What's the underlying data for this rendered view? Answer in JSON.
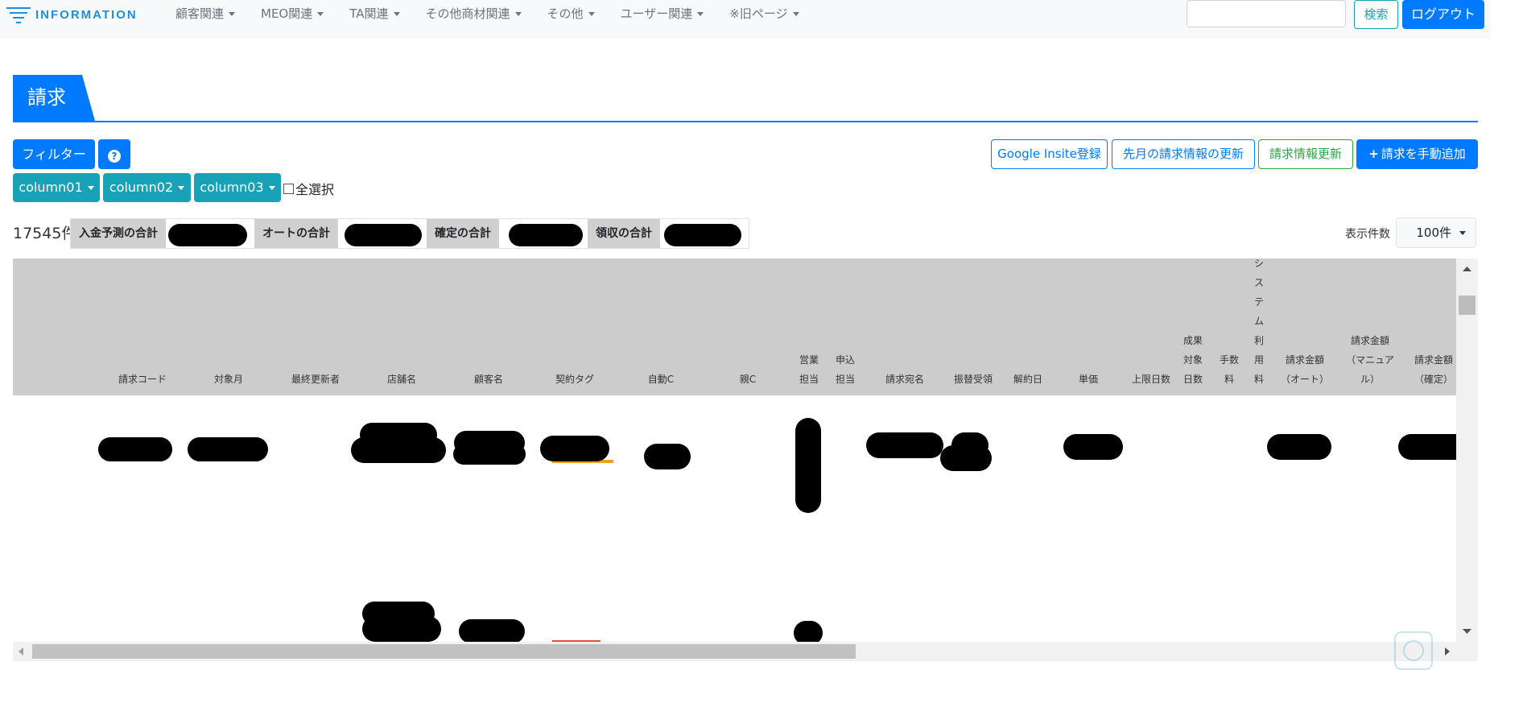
{
  "brand": {
    "logo_text": "INFORMATION"
  },
  "nav": {
    "items": [
      {
        "label": "顧客関連"
      },
      {
        "label": "MEO関連"
      },
      {
        "label": "TA関連"
      },
      {
        "label": "その他商材関連"
      },
      {
        "label": "その他"
      },
      {
        "label": "ユーザー関連"
      },
      {
        "label": "※旧ページ"
      }
    ],
    "search_placeholder": "",
    "search_button": "検索",
    "logout_button": "ログアウト"
  },
  "page": {
    "title": "請求"
  },
  "toolbar": {
    "filter_button": "フィルター",
    "help_icon": "?",
    "column_buttons": [
      "column01",
      "column02",
      "column03"
    ],
    "select_all_label": "全選択",
    "google_insite_button": "Google Insite登録",
    "update_last_month_button": "先月の請求情報の更新",
    "update_billing_button": "請求情報更新",
    "add_manual_button": "請求を手動追加",
    "plus_icon": "+"
  },
  "summary": {
    "count": "17545件",
    "totals": [
      {
        "label": "入金予測の合計"
      },
      {
        "label": "オートの合計"
      },
      {
        "label": "確定の合計"
      },
      {
        "label": "領収の合計"
      }
    ],
    "per_page_label": "表示件数",
    "per_page_value": "100件"
  },
  "table": {
    "headers": [
      "請求コード",
      "対象月",
      "最終更新者",
      "店舗名",
      "顧客名",
      "契約タグ",
      "自動C",
      "親C",
      "営業\n担当",
      "申込\n担当",
      "請求宛名",
      "振替受領",
      "解約日",
      "単価",
      "上限日数",
      "成果\n対象\n日数",
      "手数\n料",
      "シ\nス\nテ\nム\n利\n用\n料",
      "請求金額\n（オート）",
      "請求金額\n（マニュア\nル）",
      "請求金額\n（確定）"
    ]
  }
}
